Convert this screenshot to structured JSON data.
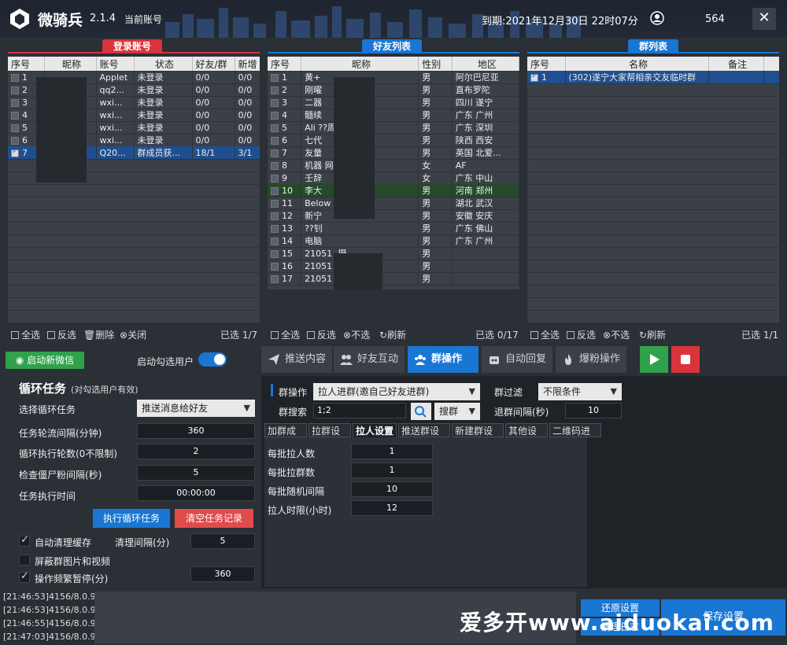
{
  "header": {
    "app_name": "微骑兵",
    "version": "2.1.4",
    "current_account_label": "当前账号",
    "expire_text": "到期:2021年12月30日 22时07分",
    "user_id_partial": "564",
    "close_glyph": "✕"
  },
  "login_panel": {
    "title": "登录账号",
    "columns": [
      "序号",
      "昵称",
      "账号",
      "状态",
      "好友/群",
      "新增"
    ],
    "rows": [
      {
        "no": "1",
        "account": "Applet",
        "status": "未登录",
        "friends": "0/0",
        "new": "0/0",
        "checked": false
      },
      {
        "no": "2",
        "account": "qq2...",
        "status": "未登录",
        "friends": "0/0",
        "new": "0/0",
        "checked": false
      },
      {
        "no": "3",
        "account": "wxi...",
        "status": "未登录",
        "friends": "0/0",
        "new": "0/0",
        "checked": false
      },
      {
        "no": "4",
        "account": "wxi...",
        "status": "未登录",
        "friends": "0/0",
        "new": "0/0",
        "checked": false
      },
      {
        "no": "5",
        "account": "wxi...",
        "status": "未登录",
        "friends": "0/0",
        "new": "0/0",
        "checked": false
      },
      {
        "no": "6",
        "account": "wxi...",
        "status": "未登录",
        "friends": "0/0",
        "new": "0/0",
        "checked": false
      },
      {
        "no": "7",
        "account": "Q20...",
        "status": "群成员获...",
        "friends": "18/1",
        "new": "3/1",
        "checked": true
      }
    ],
    "select_all": "全选",
    "invert": "反选",
    "delete": "删除",
    "close": "关闭",
    "selected_count": "已选 1/7"
  },
  "friend_panel": {
    "title": "好友列表",
    "columns": [
      "序号",
      "昵称",
      "性别",
      "地区"
    ],
    "rows": [
      {
        "no": "1",
        "nick": "黄+",
        "gender": "男",
        "region": "阿尔巴尼亚"
      },
      {
        "no": "2",
        "nick": "刚曜",
        "gender": "男",
        "region": "直布罗陀"
      },
      {
        "no": "3",
        "nick": "二器",
        "gender": "男",
        "region": "四川 遂宁"
      },
      {
        "no": "4",
        "nick": "髓续",
        "gender": "男",
        "region": "广东 广州"
      },
      {
        "no": "5",
        "nick": "Ali                ??周...",
        "gender": "男",
        "region": "广东 深圳"
      },
      {
        "no": "6",
        "nick": "七代",
        "gender": "男",
        "region": "陕西 西安"
      },
      {
        "no": "7",
        "nick": "友量",
        "gender": "男",
        "region": "英国 北爱..."
      },
      {
        "no": "8",
        "nick": "机器              网站...",
        "gender": "女",
        "region": "AF"
      },
      {
        "no": "9",
        "nick": "壬辞",
        "gender": "女",
        "region": "广东 中山"
      },
      {
        "no": "10",
        "nick": "李大",
        "gender": "男",
        "region": "河南 郑州"
      },
      {
        "no": "11",
        "nick": "Below",
        "gender": "男",
        "region": "湖北 武汉"
      },
      {
        "no": "12",
        "nick": "新宁",
        "gender": "男",
        "region": "安徽 安庆"
      },
      {
        "no": "13",
        "nick": "??钊",
        "gender": "男",
        "region": "广东 佛山"
      },
      {
        "no": "14",
        "nick": "电脑",
        "gender": "男",
        "region": "广东 广州"
      },
      {
        "no": "15",
        "nick": "21051             -摄...",
        "gender": "男",
        "region": ""
      },
      {
        "no": "16",
        "nick": "21051",
        "gender": "男",
        "region": ""
      },
      {
        "no": "17",
        "nick": "21051             售后",
        "gender": "男",
        "region": ""
      }
    ],
    "select_all": "全选",
    "invert": "反选",
    "unselect": "不选",
    "refresh": "刷新",
    "selected_count": "已选 0/17"
  },
  "group_panel": {
    "title": "群列表",
    "columns": [
      "序号",
      "名称",
      "备注"
    ],
    "rows": [
      {
        "no": "1",
        "name": "(302)遂宁大家帮相亲交友临时群",
        "note": "",
        "checked": true
      }
    ],
    "select_all": "全选",
    "invert": "反选",
    "unselect": "不选",
    "refresh": "刷新",
    "selected_count": "已选 1/1"
  },
  "left_controls": {
    "start_wechat": "启动新微信",
    "auto_select_label": "启动勾选用户",
    "auto_select_on": true,
    "loop_title": "循环任务",
    "loop_sub": "(对勾选用户有效)",
    "choose_task_label": "选择循环任务",
    "choose_task_value": "推送消息给好友",
    "rotation_label": "任务轮流间隔(分钟)",
    "rotation_value": "360",
    "rounds_label": "循环执行轮数(0不限制)",
    "rounds_value": "2",
    "zombie_label": "检查僵尸粉间隔(秒)",
    "zombie_value": "5",
    "exec_time_label": "任务执行时间",
    "exec_time_value": "00:00:00",
    "exec_btn": "执行循环任务",
    "clear_btn": "清空任务记录",
    "auto_clean_label": "自动清理缓存",
    "auto_clean_on": true,
    "clean_interval_label": "清理间隔(分)",
    "clean_interval_value": "5",
    "block_media_label": "屏蔽群图片和视频",
    "block_media_on": false,
    "pause_label": "操作频繁暂停(分)",
    "pause_on": true,
    "pause_value": "360"
  },
  "tabs": [
    {
      "label": "推送内容",
      "icon": "send-icon",
      "active": false
    },
    {
      "label": "好友互动",
      "icon": "users-icon",
      "active": false
    },
    {
      "label": "群操作",
      "icon": "group-icon",
      "active": true
    },
    {
      "label": "自动回复",
      "icon": "robot-icon",
      "active": false
    },
    {
      "label": "爆粉操作",
      "icon": "fire-icon",
      "active": false
    }
  ],
  "group_ops": {
    "op_label": "群操作",
    "op_value": "拉人进群(邀自己好友进群)",
    "filter_label": "群过滤",
    "filter_value": "不限条件",
    "search_label": "群搜索",
    "search_value": "1;2",
    "search_mode": "搜群",
    "interval_label": "退群间隔(秒)",
    "interval_value": "10",
    "subtabs": [
      "加群成员",
      "拉群设置",
      "拉人设置",
      "推送群设置",
      "新建群设置",
      "其他设置",
      "二维码进群"
    ],
    "active_subtab": "拉人设置",
    "settings": [
      {
        "label": "每批拉人数",
        "value": "1"
      },
      {
        "label": "每批拉群数",
        "value": "1"
      },
      {
        "label": "每批随机间隔",
        "value": "10"
      },
      {
        "label": "拉人时限(小时)",
        "value": "12"
      }
    ]
  },
  "log": {
    "lines": [
      "[21:46:53]4156/8.0.9",
      "[21:46:53]4156/8.0.9",
      "[21:46:55]4156/8.0.9",
      "[21:47:03]4156/8.0.9"
    ]
  },
  "footer_buttons": {
    "restore": "还原设置",
    "clear_log": "清理日志",
    "save": "保存设置"
  },
  "watermark": "爱多开www.aiduokai.com",
  "colors": {
    "accent": "#1976d2",
    "danger": "#d9333b",
    "success": "#2fa24b"
  }
}
